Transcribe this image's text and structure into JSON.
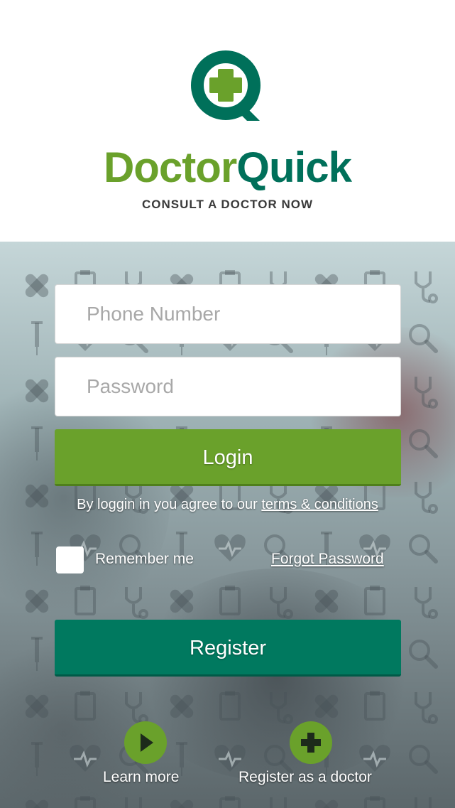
{
  "brand": {
    "name_part1": "Doctor",
    "name_part2": "Quick",
    "tagline": "CONSULT A DOCTOR NOW"
  },
  "form": {
    "phone_placeholder": "Phone Number",
    "password_placeholder": "Password",
    "login_label": "Login",
    "terms_prefix": "By loggin in you agree to our ",
    "terms_link": "terms & conditions",
    "remember_label": "Remember me",
    "remember_checked": false,
    "forgot_label": "Forgot Password",
    "register_label": "Register"
  },
  "footer": {
    "learn_more_label": "Learn more",
    "register_doctor_label": "Register as a doctor"
  },
  "colors": {
    "brand_green": "#6aa12b",
    "brand_teal": "#00705a",
    "register_teal": "#00795f"
  }
}
